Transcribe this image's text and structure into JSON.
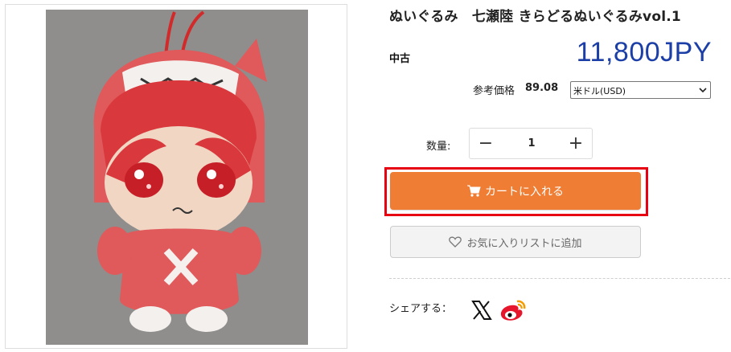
{
  "product": {
    "title": "ぬいぐるみ　七瀬陸 きらどるぬいぐるみvol.1",
    "condition": "中古",
    "price": "11,800JPY",
    "image_icon": "product-photo-plush-doll"
  },
  "reference_price": {
    "label": "参考価格",
    "value": "89.08",
    "currency_selected": "米ドル(USD)"
  },
  "quantity": {
    "label": "数量:",
    "value": "1",
    "minus_symbol": "−",
    "plus_symbol": "+"
  },
  "cart_button": {
    "label": "カートに入れる",
    "icon": "shopping-cart-icon",
    "color": "#ef7d33",
    "highlight_color": "#e60012"
  },
  "wishlist_button": {
    "label": "お気に入りリストに追加",
    "icon": "heart-outline-icon"
  },
  "share": {
    "label": "シェアする：",
    "icons": [
      "x-icon",
      "weibo-icon"
    ]
  },
  "colors": {
    "price": "#1b3fa6"
  }
}
